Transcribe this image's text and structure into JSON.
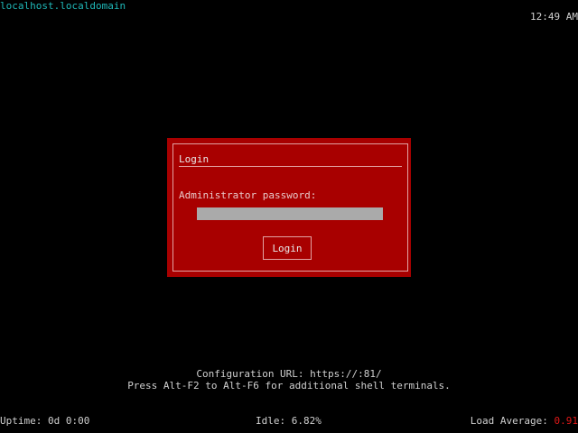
{
  "header": {
    "hostname": "localhost.localdomain",
    "clock": "12:49 AM"
  },
  "dialog": {
    "title": "Login",
    "password_label": "Administrator password:",
    "password_value": "",
    "login_button": "Login"
  },
  "footer": {
    "config_url": "Configuration URL: https://:81/",
    "shell_hint": "Press Alt-F2 to Alt-F6 for additional shell terminals."
  },
  "status": {
    "uptime": "Uptime: 0d 0:00",
    "idle": "Idle: 6.82%",
    "load_label": "Load Average: ",
    "load_value": "0.91"
  },
  "colors": {
    "background": "#000000",
    "dialog": "#a80000",
    "hostname": "#1fb8b8",
    "load_value": "#e01818"
  }
}
